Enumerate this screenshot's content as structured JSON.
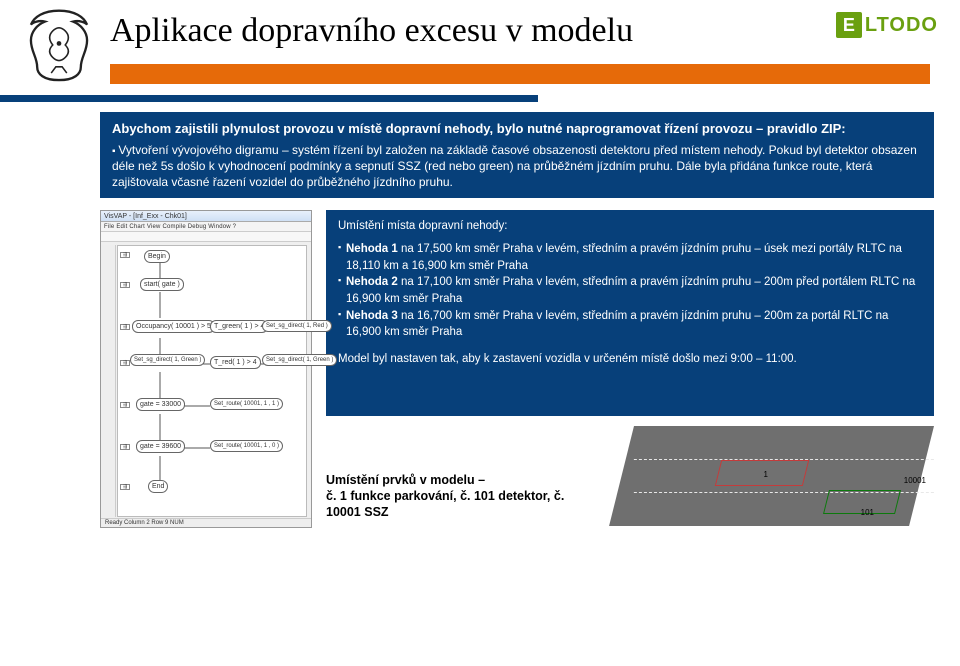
{
  "brand": {
    "eltodo_e": "E",
    "eltodo_text": "LTODO"
  },
  "title": "Aplikace dopravního excesu v modelu",
  "intro": {
    "lead": "Abychom zajistili plynulost provozu v místě dopravní nehody, bylo nutné naprogramovat řízení provozu – pravidlo ZIP:",
    "bullet": "Vytvoření vývojového digramu – systém řízení byl založen na základě časové obsazenosti detektoru před místem nehody. Pokud byl detektor obsazen déle než 5s došlo k vyhodnocení podmínky a sepnutí SSZ (red nebo green) na průběžném jízdním pruhu. Dále byla přidána funkce route, která zajištovala včasné řazení vozidel do průběžného jízdního pruhu."
  },
  "diagram": {
    "window_title": "VisVAP - [Inf_Exx - Chk01]",
    "menu": "File  Edit  Chart  View  Compile  Debug  Window  ?",
    "status": "Ready                           Column 2   Row 9     NUM",
    "nodes": {
      "begin": "Begin",
      "start": "start( gate )",
      "occ": "Occupancy( 10001 ) > 5",
      "tgreen": "T_green( 1 ) > 4",
      "setsg_red": "Set_sg_direct( 1, Red )",
      "set_green": "Set_sg_direct( 1, Green )",
      "tred": "T_red( 1 ) > 4",
      "setsg_green": "Set_sg_direct( 1, Green )",
      "gate1": "gate = 33000",
      "route1": "Set_route( 10001, 1 , 1 )",
      "gate2": "gate = 39600",
      "route2": "Set_route( 10001, 1 , 0 )",
      "end": "End"
    }
  },
  "placement": {
    "head": "Umístění místa dopravní nehody:",
    "n1a": "Nehoda 1",
    "n1b": " na 17,500 km směr Praha v levém, středním a pravém jízdním pruhu – úsek mezi portály RLTC na 18,110 km a 16,900 km směr Praha",
    "n2a": "Nehoda 2",
    "n2b": " na 17,100 km směr Praha v levém, středním a pravém jízdním pruhu – 200m před portálem RLTC na 16,900 km směr Praha",
    "n3a": "Nehoda 3",
    "n3b": " na 16,700 km směr Praha v levém, středním a pravém jízdním pruhu – 200m za portál RLTC na 16,900 km směr Praha",
    "model": "Model byl nastaven tak, aby k zastavení vozidla v určeném místě došlo mezi 9:00 – 11:00."
  },
  "road": {
    "caption1": "Umístění prvků v modelu –",
    "caption2": "č. 1 funkce parkování, č. 101 detektor, č. 10001 SSZ",
    "label1": "1",
    "label10001": "10001",
    "label101": "101"
  }
}
